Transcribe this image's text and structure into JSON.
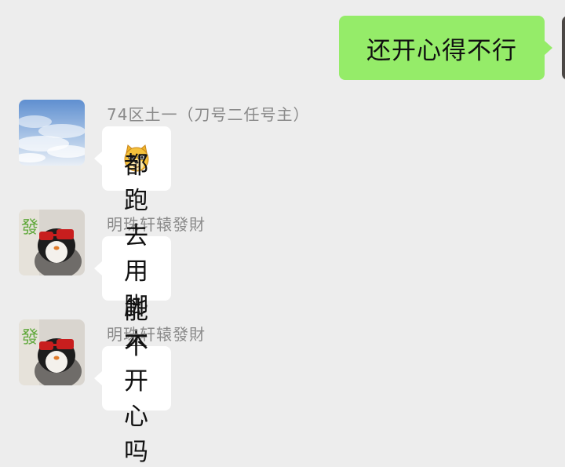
{
  "messages": [
    {
      "direction": "outgoing",
      "text": "还开心得不行"
    },
    {
      "direction": "incoming",
      "sender": "74区土一（刀号二任号主）",
      "avatar": "sky-avatar",
      "content_type": "emoji",
      "emoji": "doge-emoji"
    },
    {
      "direction": "incoming",
      "sender": "明珠轩辕發財",
      "avatar": "penguin-avatar",
      "text": "都跑去用脚本了"
    },
    {
      "direction": "incoming",
      "sender": "明珠轩辕發財",
      "avatar": "penguin-avatar",
      "text": "能不开心吗"
    }
  ],
  "colors": {
    "background": "#ededed",
    "outgoing_bubble": "#95ec69",
    "incoming_bubble": "#ffffff",
    "sender_name": "#8a8a8a"
  }
}
